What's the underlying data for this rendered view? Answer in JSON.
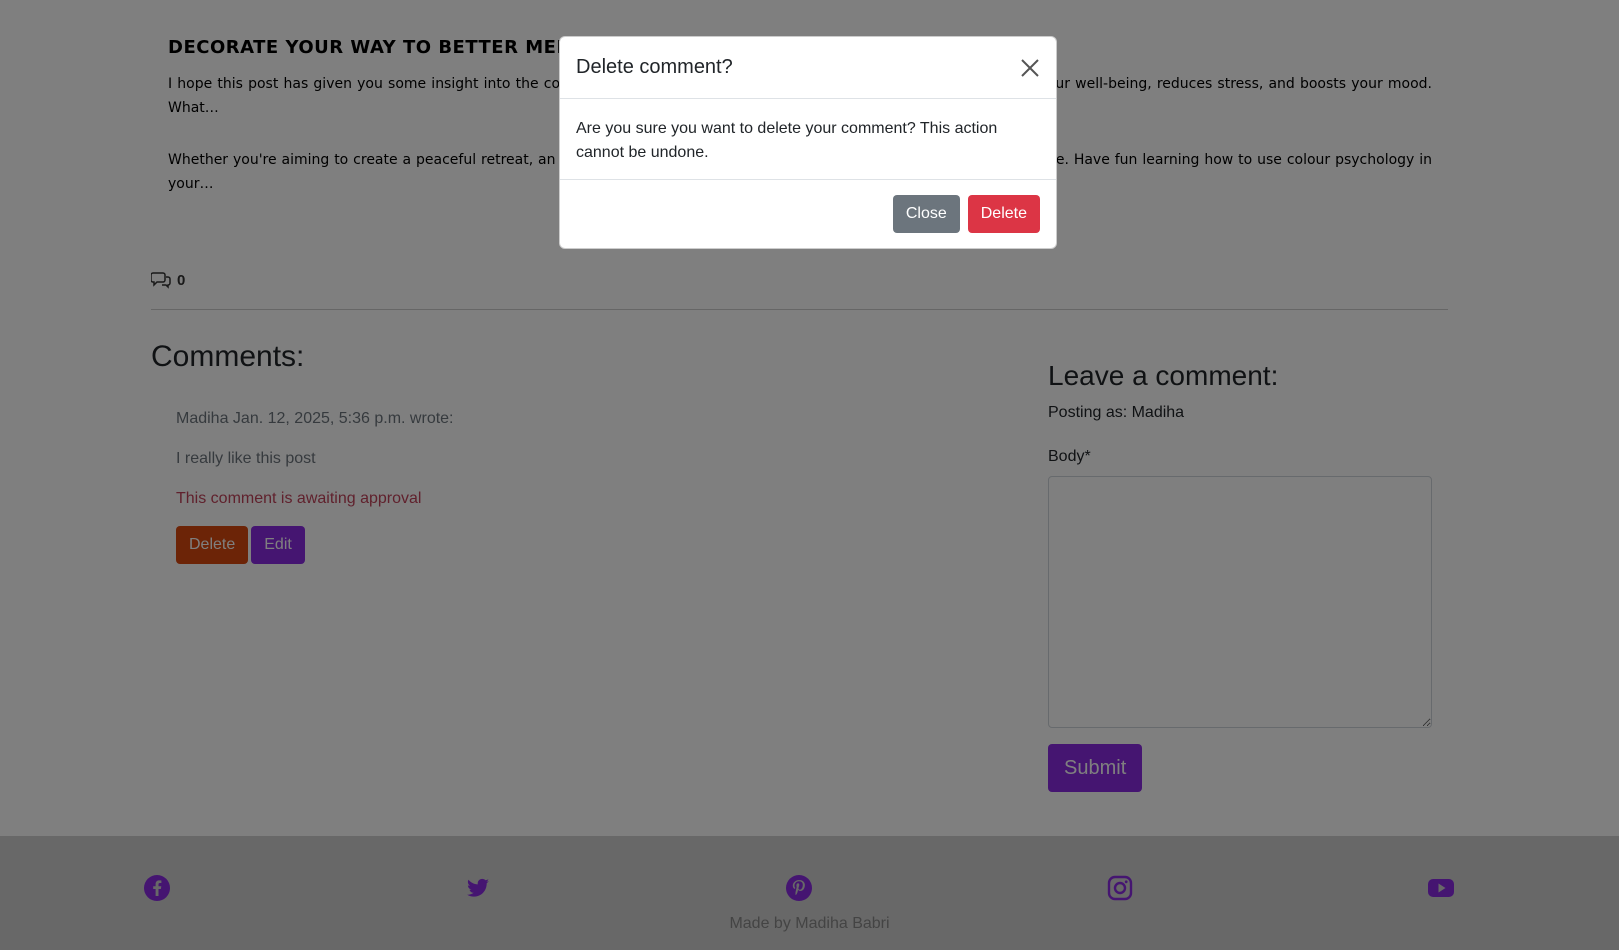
{
  "post": {
    "heading": "Decorate your way to better mental health",
    "paragraphs": [
      "I hope this post has given you some insight into the colours … by selecting colours, you can create a space that nurtures your well-being, reduces stress, and boosts your mood. What…",
      "Whether you're aiming to create a peaceful retreat, an ene… you achieve your mental health goals, one brushstroke at a time. Have fun learning how to use colour psychology in your…"
    ]
  },
  "comment_count": "0",
  "comments": {
    "title": "Comments:",
    "items": [
      {
        "meta": "Madiha Jan. 12, 2025, 5:36 p.m. wrote:",
        "body": "I really like this post",
        "status": "This comment is awaiting approval",
        "delete_label": "Delete",
        "edit_label": "Edit"
      }
    ]
  },
  "leave_comment": {
    "title": "Leave a comment:",
    "posting_as": "Posting as: Madiha",
    "body_label": "Body*",
    "body_value": "",
    "submit_label": "Submit"
  },
  "footer": {
    "socials": [
      "facebook-icon",
      "twitter-icon",
      "pinterest-icon",
      "instagram-icon",
      "youtube-icon"
    ],
    "credit": "Made by Madiha Babri",
    "icon_color": "#8a2be2"
  },
  "modal": {
    "title": "Delete comment?",
    "message": "Are you sure you want to delete your comment? This action cannot be undone.",
    "close_label": "Close",
    "delete_label": "Delete"
  },
  "colors": {
    "accent": "#8a2be2",
    "danger": "#dc3545",
    "secondary": "#6c757d",
    "delete_comment": "#d9480f",
    "awaiting": "#c0435a"
  }
}
